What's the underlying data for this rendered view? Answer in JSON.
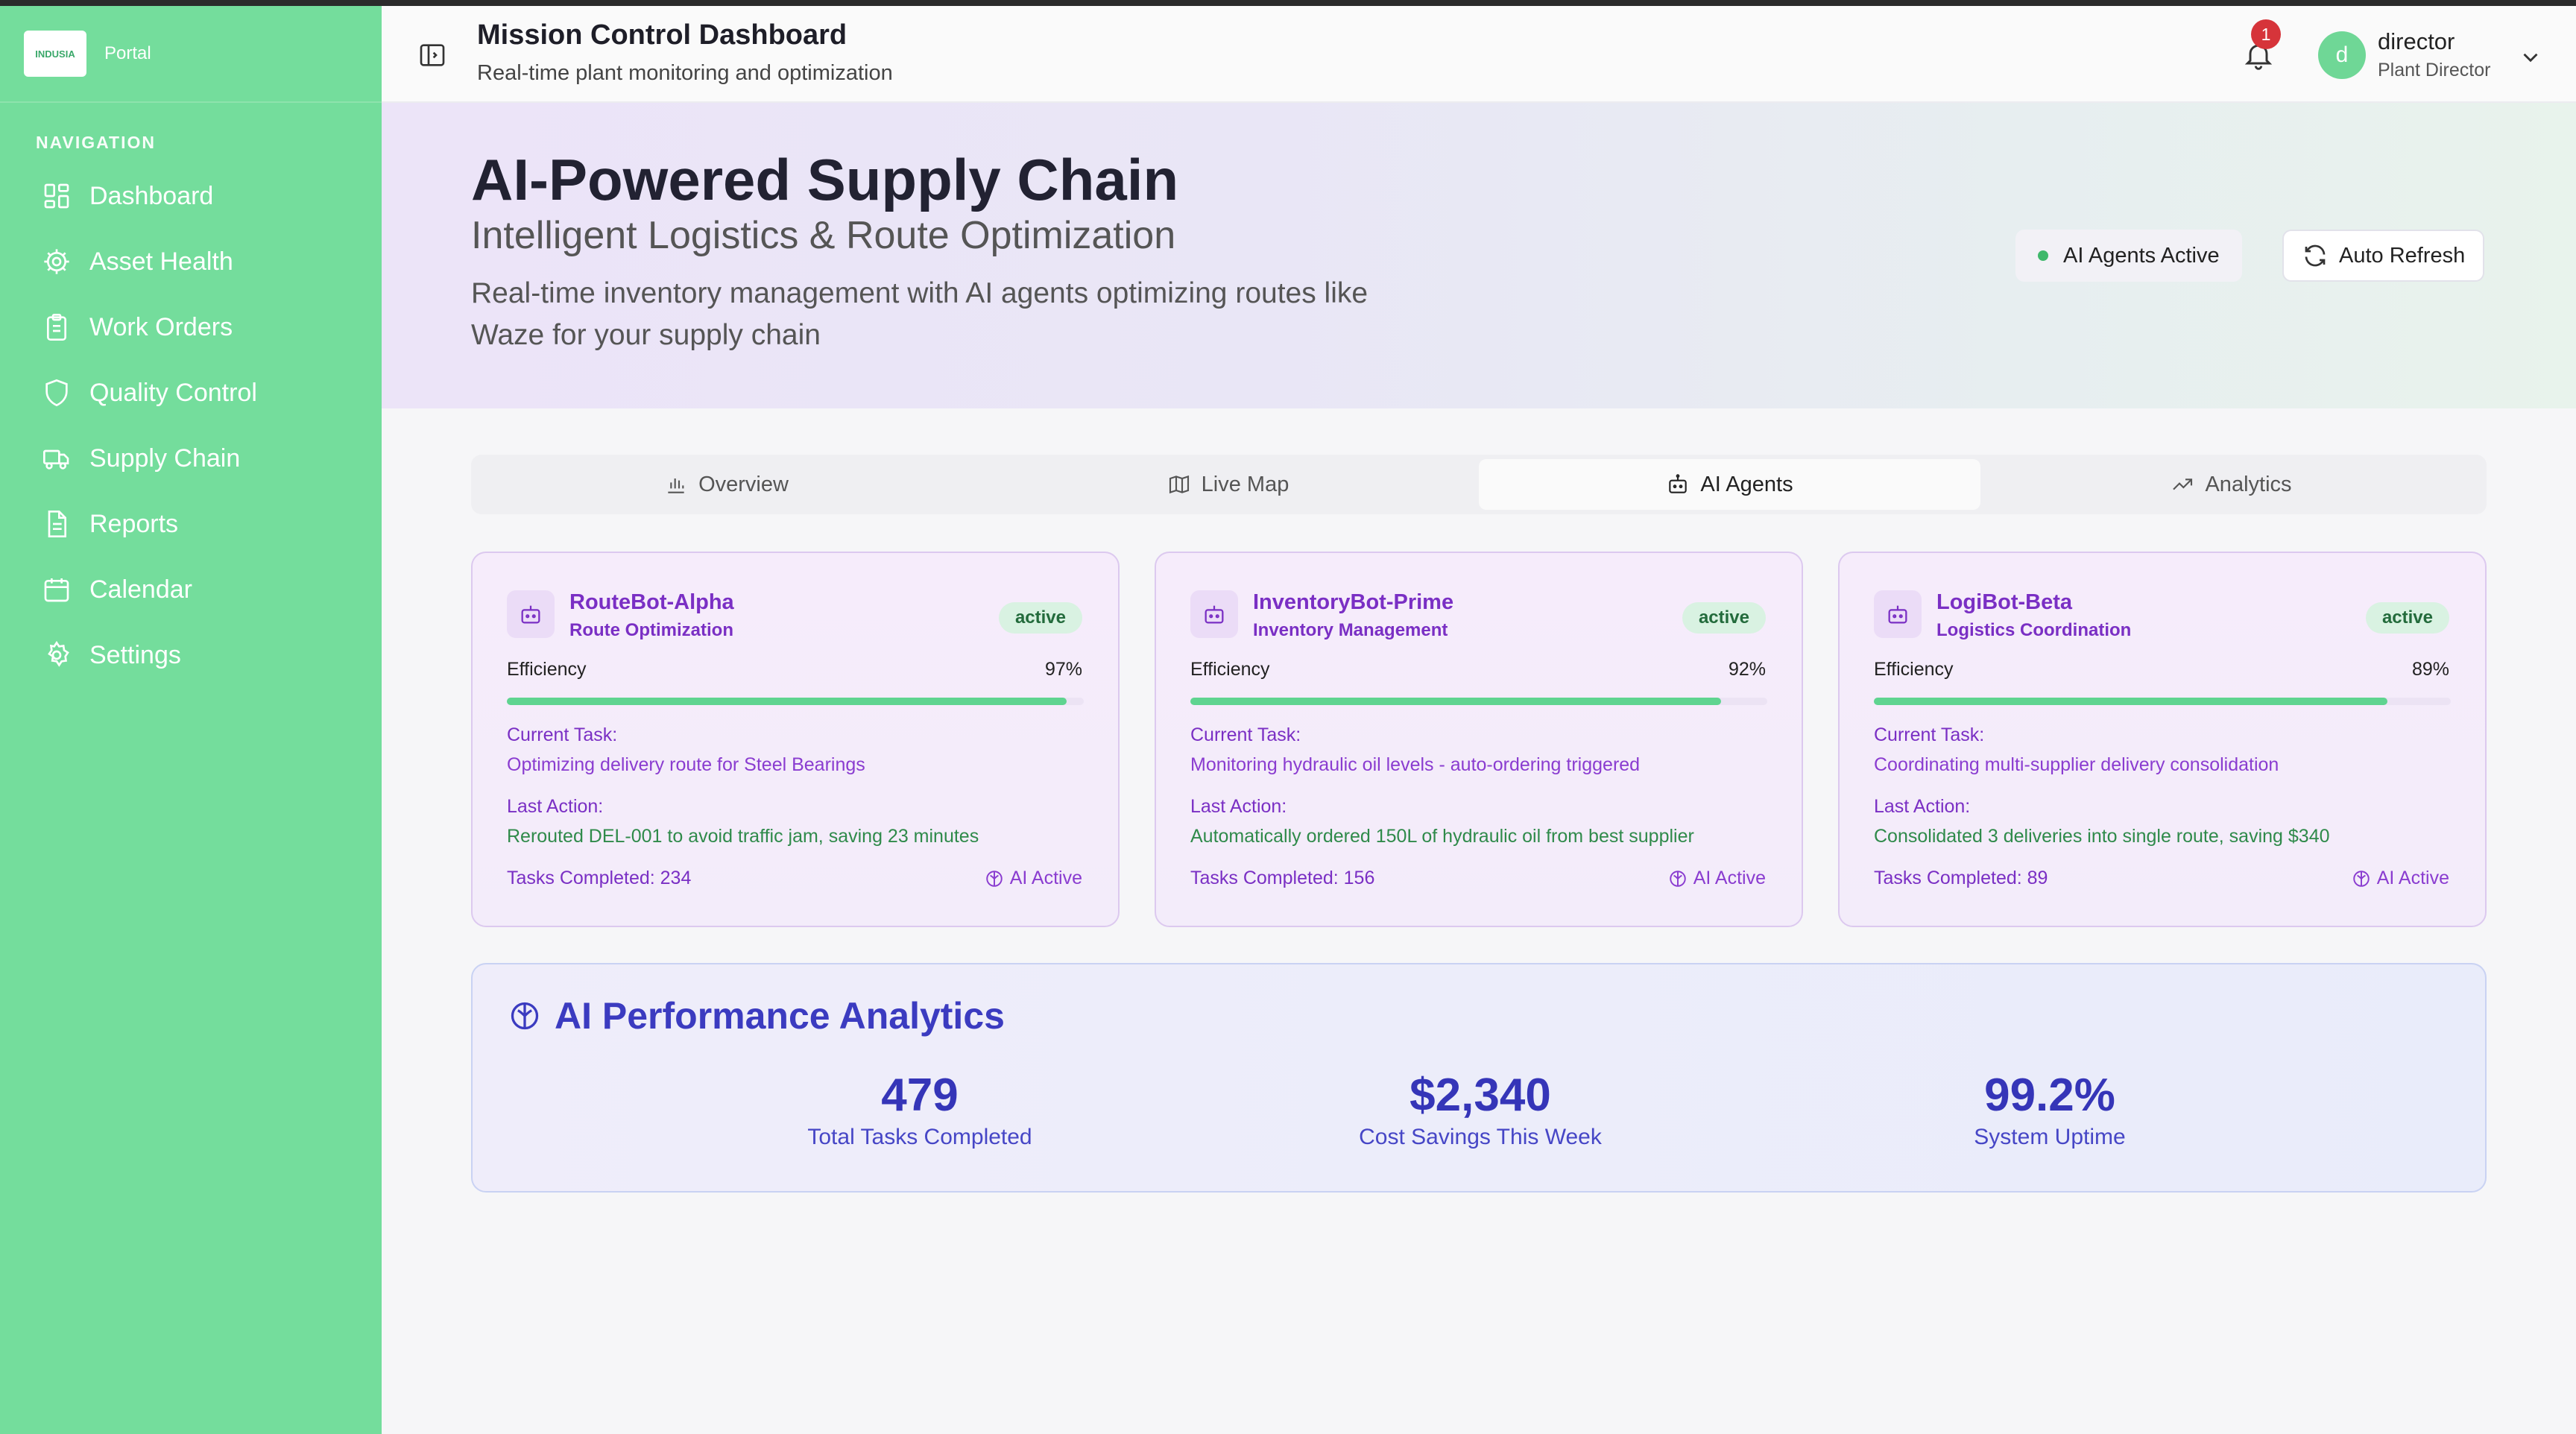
{
  "brand": {
    "logo_text": "INDUSIA",
    "portal": "Portal"
  },
  "sidebar": {
    "heading": "NAVIGATION",
    "items": [
      {
        "label": "Dashboard",
        "icon": "grid-icon"
      },
      {
        "label": "Asset Health",
        "icon": "gear-icon"
      },
      {
        "label": "Work Orders",
        "icon": "clipboard-icon"
      },
      {
        "label": "Quality Control",
        "icon": "shield-icon"
      },
      {
        "label": "Supply Chain",
        "icon": "truck-icon"
      },
      {
        "label": "Reports",
        "icon": "document-icon"
      },
      {
        "label": "Calendar",
        "icon": "calendar-icon"
      },
      {
        "label": "Settings",
        "icon": "settings-icon"
      }
    ]
  },
  "header": {
    "title": "Mission Control Dashboard",
    "subtitle": "Real-time plant monitoring and optimization",
    "notifications": "1",
    "user": {
      "initial": "d",
      "name": "director",
      "role": "Plant Director"
    }
  },
  "hero": {
    "title": "AI-Powered Supply Chain",
    "subtitle": "Intelligent Logistics & Route Optimization",
    "description": "Real-time inventory management with AI agents optimizing routes like Waze for your supply chain",
    "agents_status": "AI Agents Active",
    "refresh_label": "Auto Refresh"
  },
  "tabs": [
    {
      "label": "Overview",
      "icon": "bar-chart-icon"
    },
    {
      "label": "Live Map",
      "icon": "map-icon"
    },
    {
      "label": "AI Agents",
      "icon": "bot-icon",
      "active": true
    },
    {
      "label": "Analytics",
      "icon": "trend-icon"
    }
  ],
  "agents": [
    {
      "name": "RouteBot-Alpha",
      "role": "Route Optimization",
      "status": "active",
      "efficiency_label": "Efficiency",
      "efficiency": "97%",
      "current_task_label": "Current Task:",
      "current_task": "Optimizing delivery route for Steel Bearings",
      "last_action_label": "Last Action:",
      "last_action": "Rerouted DEL-001 to avoid traffic jam, saving 23 minutes",
      "tasks_completed": "Tasks Completed: 234",
      "ai_status": "AI Active"
    },
    {
      "name": "InventoryBot-Prime",
      "role": "Inventory Management",
      "status": "active",
      "efficiency_label": "Efficiency",
      "efficiency": "92%",
      "current_task_label": "Current Task:",
      "current_task": "Monitoring hydraulic oil levels - auto-ordering triggered",
      "last_action_label": "Last Action:",
      "last_action": "Automatically ordered 150L of hydraulic oil from best supplier",
      "tasks_completed": "Tasks Completed: 156",
      "ai_status": "AI Active"
    },
    {
      "name": "LogiBot-Beta",
      "role": "Logistics Coordination",
      "status": "active",
      "efficiency_label": "Efficiency",
      "efficiency": "89%",
      "current_task_label": "Current Task:",
      "current_task": "Coordinating multi-supplier delivery consolidation",
      "last_action_label": "Last Action:",
      "last_action": "Consolidated 3 deliveries into single route, saving $340",
      "tasks_completed": "Tasks Completed: 89",
      "ai_status": "AI Active"
    }
  ],
  "analytics": {
    "title": "AI Performance Analytics",
    "stats": [
      {
        "value": "479",
        "label": "Total Tasks Completed"
      },
      {
        "value": "$2,340",
        "label": "Cost Savings This Week"
      },
      {
        "value": "99.2%",
        "label": "System Uptime"
      }
    ]
  },
  "colors": {
    "sidebar": "#74dd9c",
    "accent_purple": "#7a2fc4",
    "analytics_blue": "#3535b8",
    "active_green": "#5fd490"
  }
}
